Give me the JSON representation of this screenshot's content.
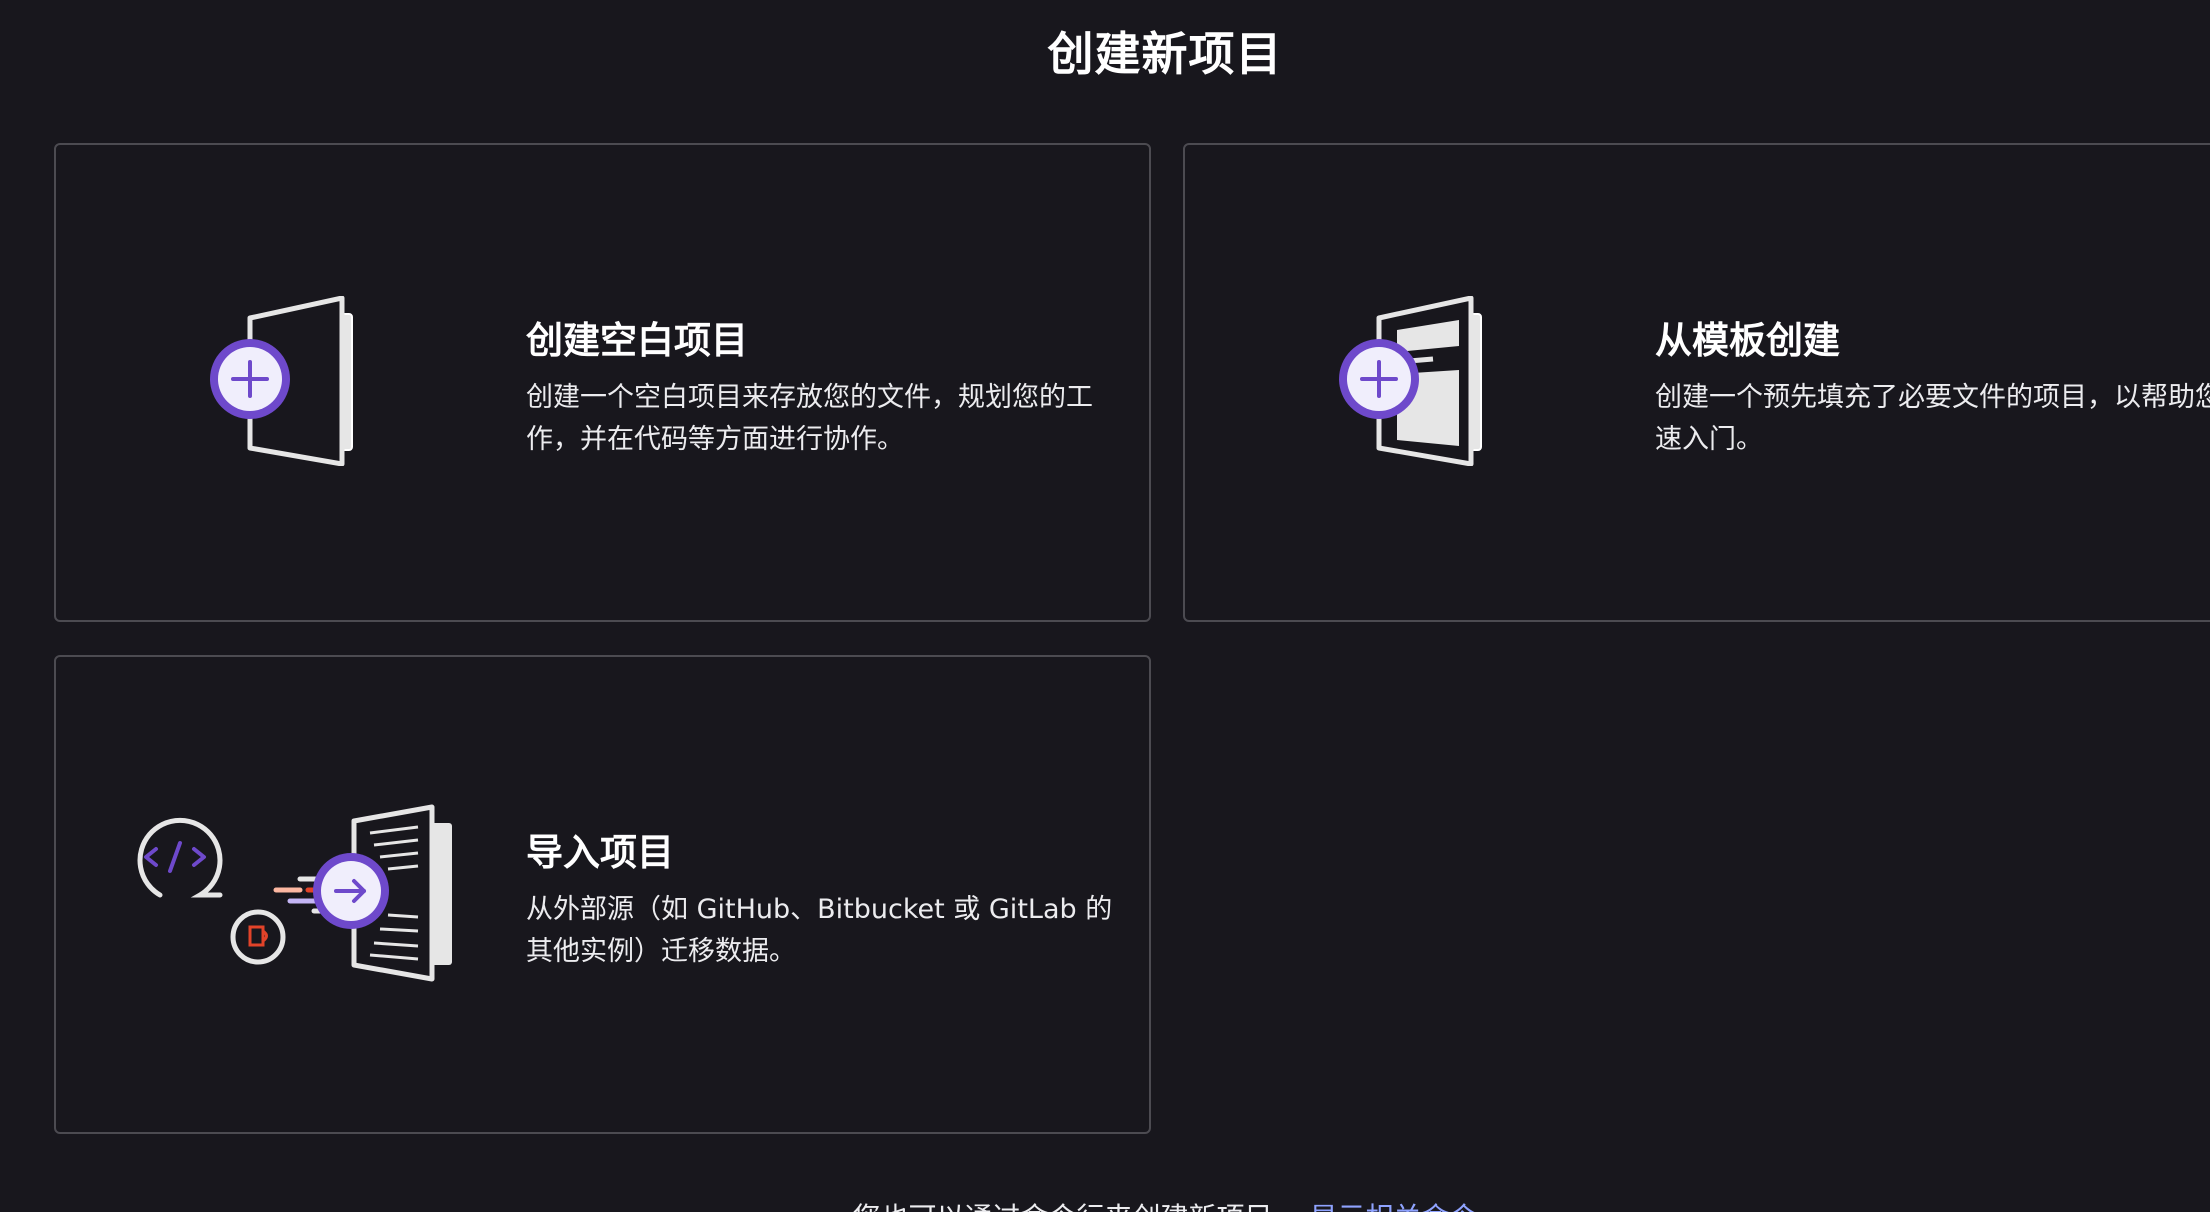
{
  "page": {
    "title": "创建新项目"
  },
  "cards": [
    {
      "title": "创建空白项目",
      "description": "创建一个空白项目来存放您的文件，规划您的工作，并在代码等方面进行协作。",
      "icon": "blank-project-icon"
    },
    {
      "title": "从模板创建",
      "description": "创建一个预先填充了必要文件的项目，以帮助您快速入门。",
      "icon": "template-project-icon"
    },
    {
      "title": "导入项目",
      "description": "从外部源（如 GitHub、Bitbucket 或 GitLab 的其他实例）迁移数据。",
      "icon": "import-project-icon"
    }
  ],
  "footer": {
    "text": "您也可以通过命令行来创建新项目。",
    "link": "显示相关命令"
  },
  "colors": {
    "background": "#18171d",
    "border": "#4c4b51",
    "accent_purple": "#6e49cb",
    "link": "#8fa3ff"
  }
}
